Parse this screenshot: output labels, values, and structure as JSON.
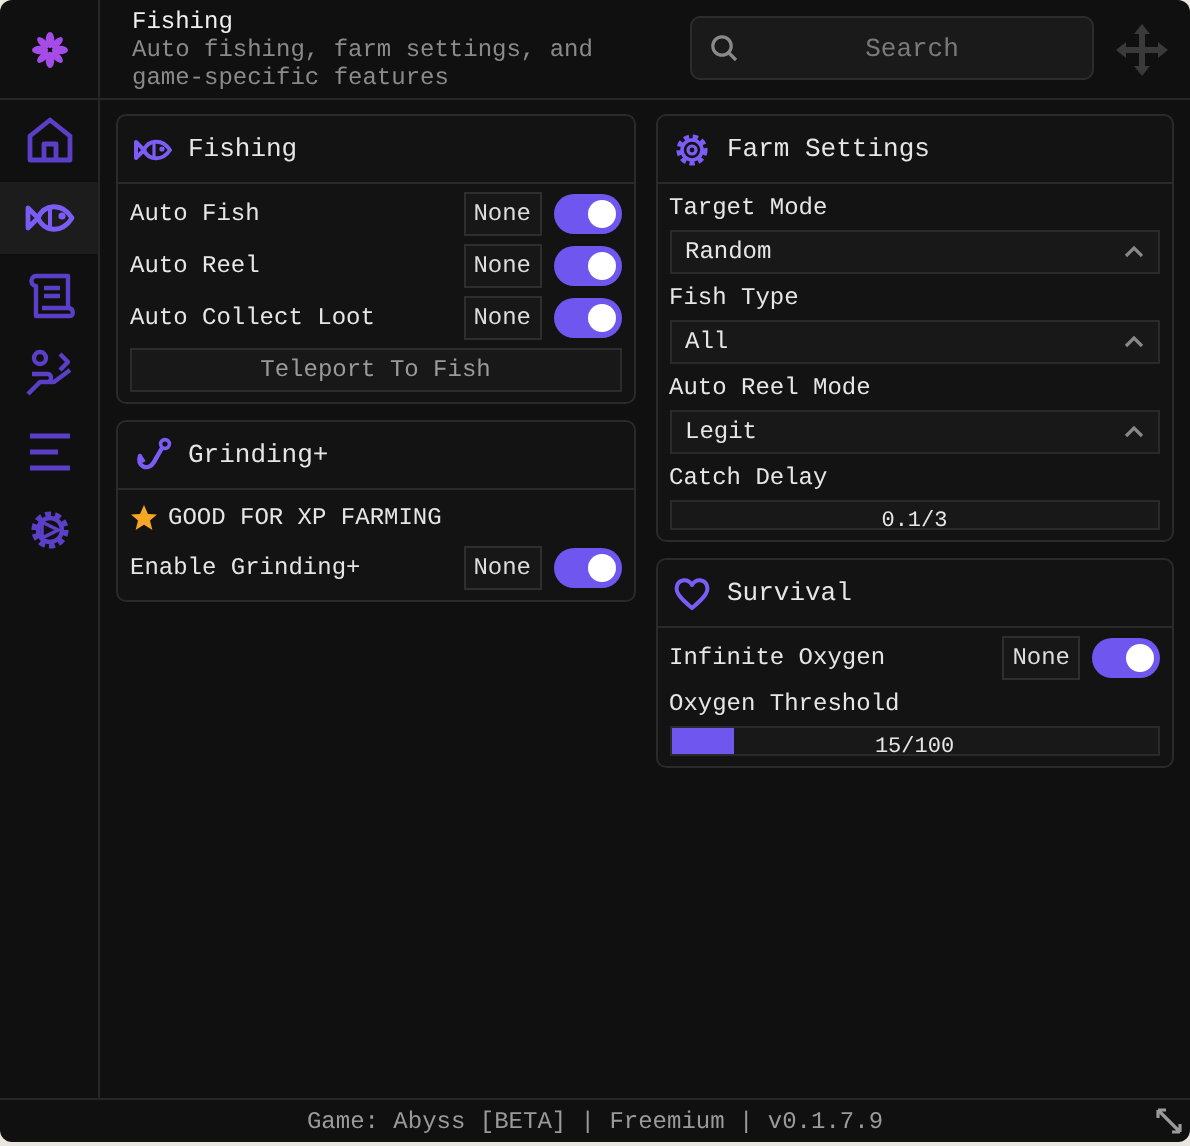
{
  "header": {
    "title": "Fishing",
    "subtitle": "Auto fishing, farm settings, and game-specific features",
    "search": {
      "placeholder": "Search"
    }
  },
  "sidebar": {
    "items": [
      {
        "selected": false
      },
      {
        "selected": true
      },
      {
        "selected": false
      },
      {
        "selected": false
      },
      {
        "selected": false
      },
      {
        "selected": false
      }
    ]
  },
  "columns": [
    {
      "panels": [
        {
          "title": "Fishing",
          "rows": [
            {
              "kind": "toggle",
              "label": "Auto Fish",
              "keybind": "None",
              "on": true
            },
            {
              "kind": "toggle",
              "label": "Auto Reel",
              "keybind": "None",
              "on": true
            },
            {
              "kind": "toggle",
              "label": "Auto Collect Loot",
              "keybind": "None",
              "on": true
            },
            {
              "kind": "button",
              "label": "Teleport To Fish"
            }
          ]
        },
        {
          "title": "Grinding+",
          "rows": [
            {
              "kind": "note",
              "label": "GOOD FOR XP FARMING"
            },
            {
              "kind": "toggle",
              "label": "Enable Grinding+",
              "keybind": "None",
              "on": true
            }
          ]
        }
      ]
    },
    {
      "panels": [
        {
          "title": "Farm Settings",
          "rows": [
            {
              "kind": "dropdown",
              "label": "Target Mode",
              "value": "Random"
            },
            {
              "kind": "dropdown",
              "label": "Fish Type",
              "value": "All"
            },
            {
              "kind": "dropdown",
              "label": "Auto Reel Mode",
              "value": "Legit"
            },
            {
              "kind": "slider",
              "label": "Catch Delay",
              "reading": "0.1/3",
              "level": 0
            }
          ]
        },
        {
          "title": "Survival",
          "rows": [
            {
              "kind": "toggle",
              "label": "Infinite Oxygen",
              "keybind": "None",
              "on": true
            },
            {
              "kind": "slider",
              "label": "Oxygen Threshold",
              "reading": "15/100",
              "level": 0.13
            }
          ]
        }
      ]
    }
  ],
  "status_bar": "Game: Abyss [BETA] | Freemium | v0.1.7.9"
}
